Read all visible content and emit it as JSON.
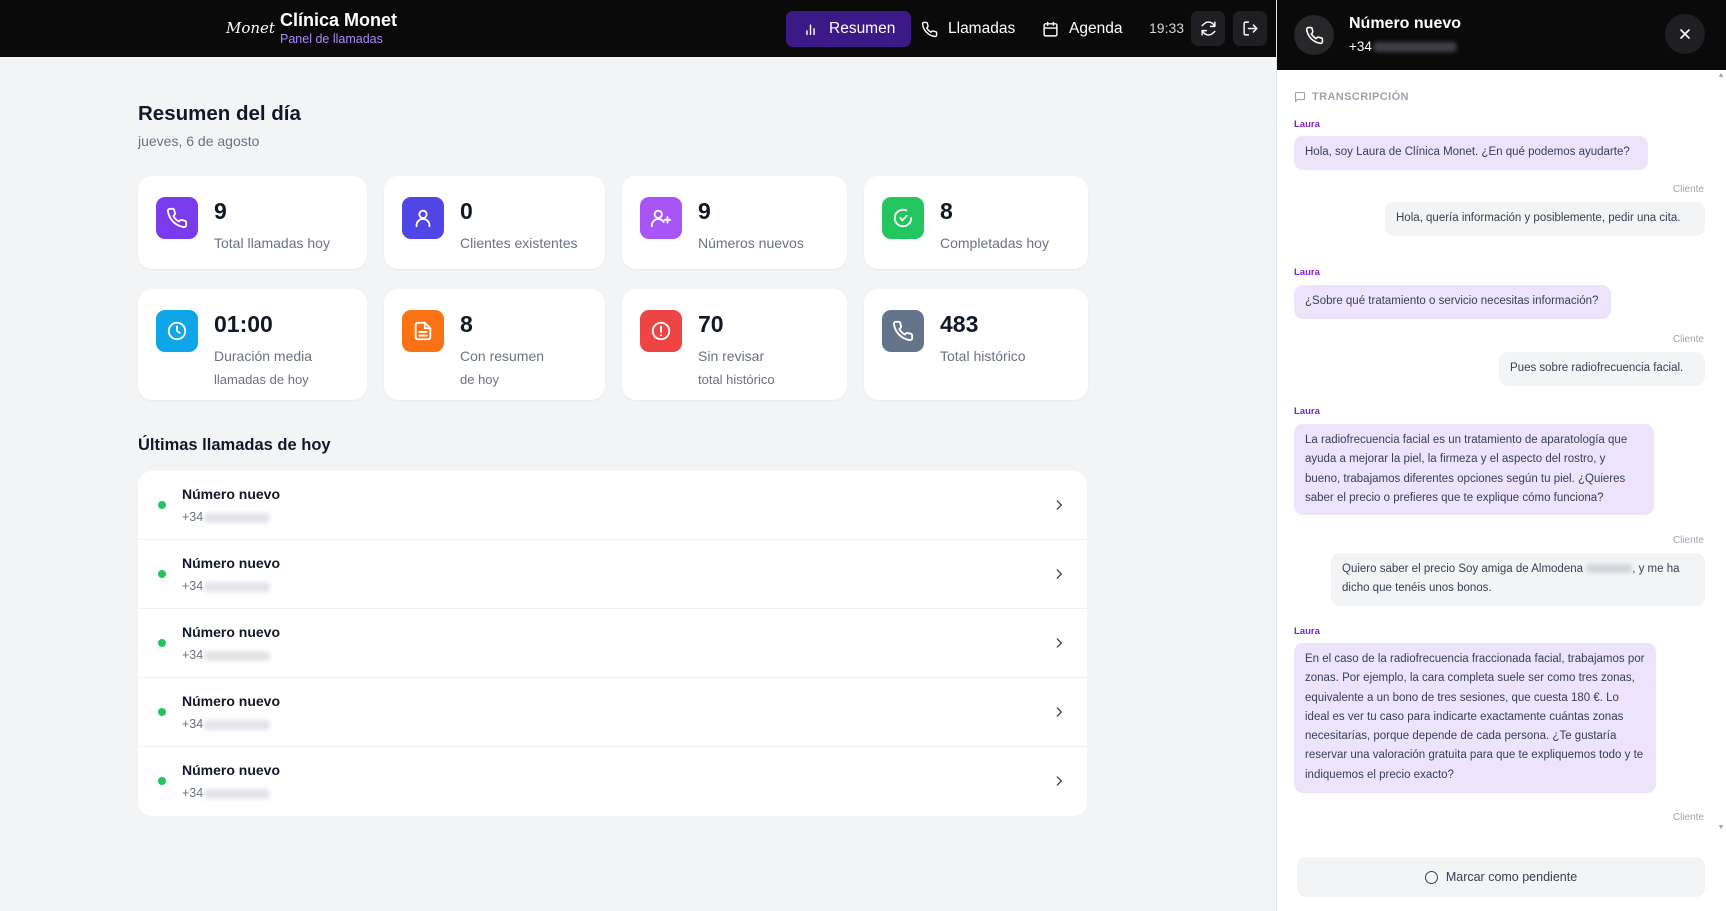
{
  "header": {
    "logo_text": "Monet",
    "brand_name": "Clínica Monet",
    "brand_sub": "Panel de llamadas",
    "nav": [
      {
        "label": "Resumen"
      },
      {
        "label": "Llamadas"
      },
      {
        "label": "Agenda"
      }
    ],
    "time": "19:33"
  },
  "summary": {
    "title": "Resumen del día",
    "date": "jueves, 6 de agosto"
  },
  "cards": [
    {
      "value": "9",
      "label": "Total llamadas hoy",
      "color": "#7c3aed",
      "icon": "phone-icon"
    },
    {
      "value": "0",
      "label": "Clientes existentes",
      "color": "#4f46e5",
      "icon": "user-icon"
    },
    {
      "value": "9",
      "label": "Números nuevos",
      "color": "#a855f7",
      "icon": "user-plus-icon"
    },
    {
      "value": "8",
      "label": "Completadas hoy",
      "color": "#22c55e",
      "icon": "check-circle-icon"
    },
    {
      "value": "01:00",
      "label": "Duración media",
      "label2": "llamadas de hoy",
      "color": "#0ea5e9",
      "icon": "clock-icon"
    },
    {
      "value": "8",
      "label": "Con resumen",
      "label2": "de hoy",
      "color": "#f97316",
      "icon": "document-icon"
    },
    {
      "value": "70",
      "label": "Sin revisar",
      "label2": "total histórico",
      "color": "#ef4444",
      "icon": "alert-circle-icon"
    },
    {
      "value": "483",
      "label": "Total histórico",
      "color": "#64748b",
      "icon": "phone-icon"
    }
  ],
  "recent": {
    "title": "Últimas llamadas de hoy",
    "calls": [
      {
        "name": "Número nuevo",
        "prefix": "+34"
      },
      {
        "name": "Número nuevo",
        "prefix": "+34"
      },
      {
        "name": "Número nuevo",
        "prefix": "+34"
      },
      {
        "name": "Número nuevo",
        "prefix": "+34"
      },
      {
        "name": "Número nuevo",
        "prefix": "+34"
      }
    ]
  },
  "panel": {
    "title": "Número nuevo",
    "prefix": "+34",
    "transcript_label": "TRANSCRIPCIÓN",
    "messages": [
      {
        "speaker": "Laura",
        "text": "Hola, soy Laura de Clínica Monet. ¿En qué podemos ayudarte?"
      },
      {
        "speaker": "Cliente",
        "text": "Hola, quería información y posiblemente, pedir una cita."
      },
      {
        "speaker": "Laura",
        "text": "¿Sobre qué tratamiento o servicio necesitas información?"
      },
      {
        "speaker": "Cliente",
        "text": "Pues sobre radiofrecuencia facial."
      },
      {
        "speaker": "Laura",
        "text": "La radiofrecuencia facial es un tratamiento de aparatología que ayuda a mejorar la piel, la firmeza y el aspecto del rostro, y bueno, trabajamos diferentes opciones según tu piel. ¿Quieres saber el precio o prefieres que te explique cómo funciona?"
      },
      {
        "speaker": "Cliente",
        "text_a": "Quiero saber el precio Soy amiga de Almodena",
        "text_b": ", y me ha dicho que tenéis unos bonos."
      },
      {
        "speaker": "Laura",
        "text": "En el caso de la radiofrecuencia fraccionada facial, trabajamos por zonas. Por ejemplo, la cara completa suele ser como tres zonas, equivalente a un bono de tres sesiones, que cuesta 180 €. Lo ideal es ver tu caso para indicarte exactamente cuántas zonas necesitarías, porque depende de cada persona. ¿Te gustaría reservar una valoración gratuita para que te expliquemos todo y te indiquemos el precio exacto?"
      },
      {
        "speaker": "Cliente"
      }
    ],
    "pending_label": "Marcar como pendiente"
  }
}
